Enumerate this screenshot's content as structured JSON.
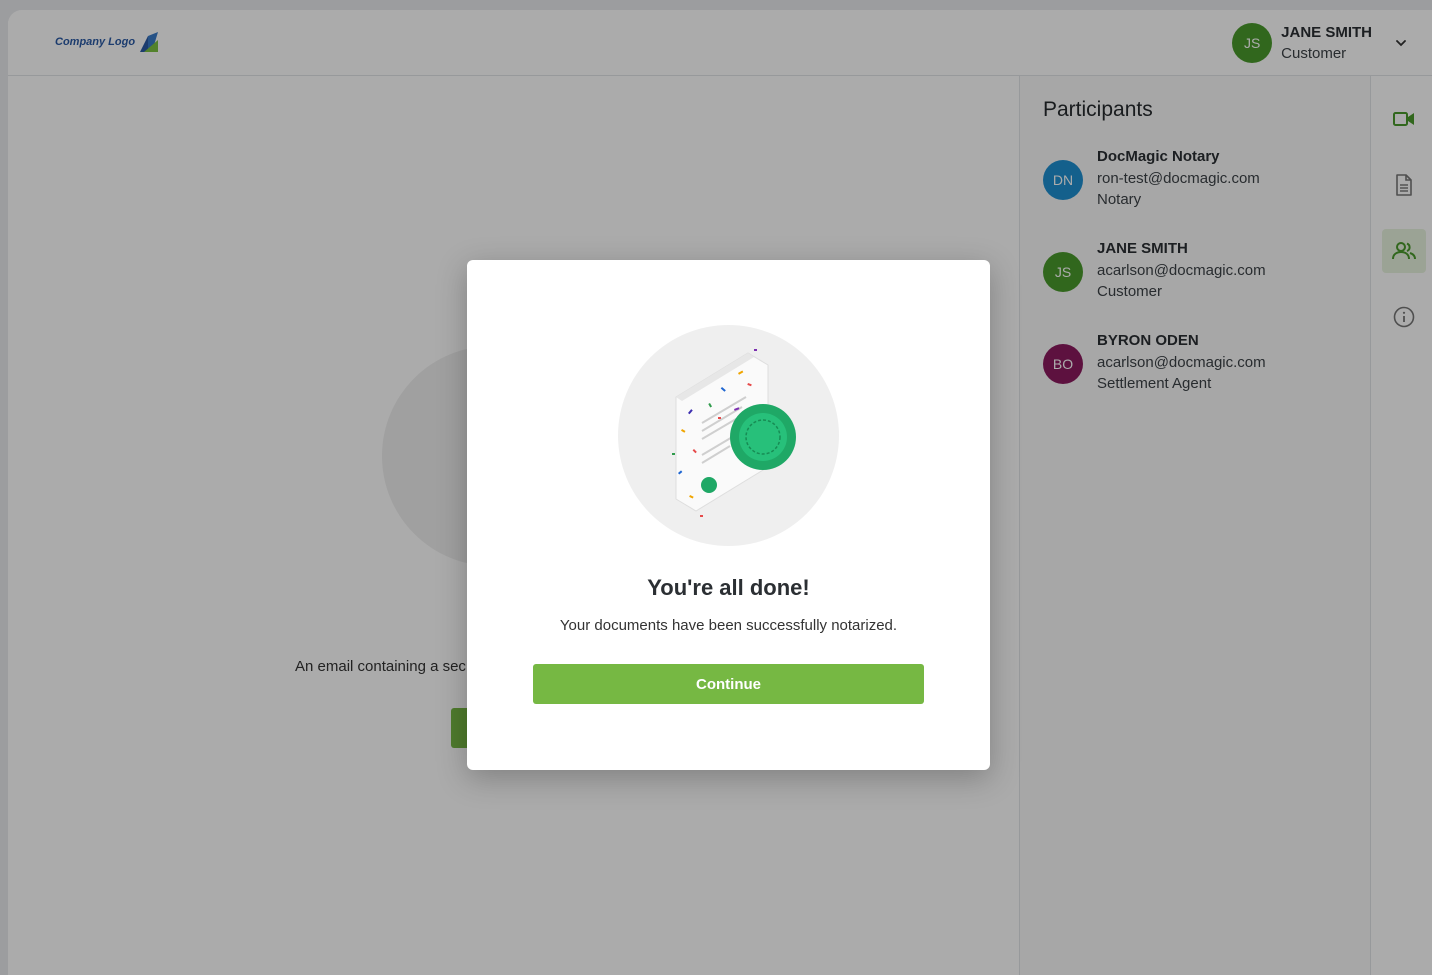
{
  "brand": {
    "logo_text": "Company Logo"
  },
  "header": {
    "user": {
      "initials": "JS",
      "name": "JANE SMITH",
      "role": "Customer",
      "avatar_color": "#4a9a2c"
    }
  },
  "background": {
    "email_text": "An email containing a sec"
  },
  "participants": {
    "title": "Participants",
    "items": [
      {
        "initials": "DN",
        "name": "DocMagic Notary",
        "email": "ron-test@docmagic.com",
        "role": "Notary",
        "color": "#1f8fd1"
      },
      {
        "initials": "JS",
        "name": "JANE SMITH",
        "email": "acarlson@docmagic.com",
        "role": "Customer",
        "color": "#4a9a2c"
      },
      {
        "initials": "BO",
        "name": "BYRON ODEN",
        "email": "acarlson@docmagic.com",
        "role": "Settlement Agent",
        "color": "#8b1a5e"
      }
    ]
  },
  "rail": {
    "items": [
      "video-icon",
      "document-icon",
      "participants-icon",
      "info-icon"
    ],
    "active": "participants-icon"
  },
  "modal": {
    "title": "You're all done!",
    "message": "Your documents have been successfully notarized.",
    "continue_label": "Continue"
  },
  "colors": {
    "accent": "#76b843",
    "overlay": "rgba(0,0,0,0.33)"
  }
}
